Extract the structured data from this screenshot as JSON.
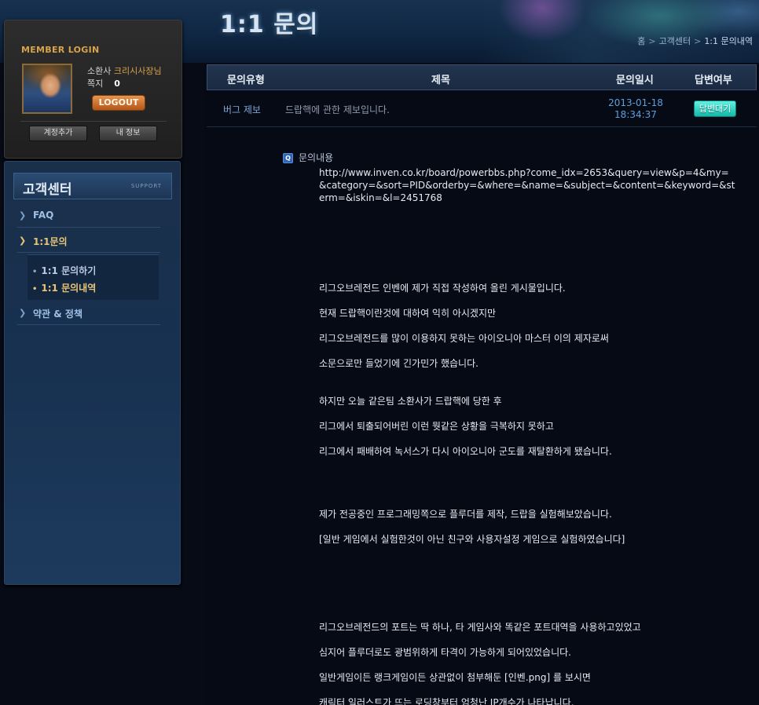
{
  "header": {
    "title": "1:1 문의",
    "breadcrumb": [
      "홈",
      "고객센터",
      "1:1 문의내역"
    ],
    "breadcrumb_sep": ">"
  },
  "login": {
    "title": "MEMBER LOGIN",
    "user_prefix": "소환사",
    "nickname": "크리시사장님",
    "message_label": "쪽지",
    "message_count": "0",
    "logout_label": "LOGOUT",
    "add_account_label": "계정추가",
    "my_info_label": "내 정보"
  },
  "support": {
    "title": "고객센터",
    "subtitle": "SUPPORT",
    "nav": [
      {
        "label": "FAQ"
      },
      {
        "label": "1:1문의"
      },
      {
        "label": "약관 & 정책"
      }
    ],
    "sub_nav": [
      {
        "label": "1:1 문의하기"
      },
      {
        "label": "1:1 문의내역"
      }
    ]
  },
  "table": {
    "headers": {
      "type": "문의유형",
      "subject": "제목",
      "date": "문의일시",
      "status": "답변여부"
    },
    "row": {
      "type": "버그 제보",
      "subject": "드랍핵에 관한 제보입니다.",
      "date": "2013-01-18",
      "time": "18:34:37",
      "status": "답변대기"
    }
  },
  "inquiry": {
    "label": "문의내용",
    "url": "http://www.inven.co.kr/board/powerbbs.php?come_idx=2653&query=view&p=4&my=&category=&sort=PID&orderby=&where=&name=&subject=&content=&keyword=&sterm=&iskin=&l=2451768",
    "lines": [
      "리그오브레전드 인벤에 제가 직접 작성하여 올린 게시물입니다.",
      "현재 드랍핵이란것에 대하여 익히 아시겠지만",
      "리그오브레전드를 많이 이용하지 못하는 아이오니아 마스터 이의 제자로써",
      "소문으로만 들었기에 긴가민가 했습니다.",
      "하지만 오늘 같은팀 소환사가 드랍핵에 당한 후",
      "리그에서 퇴출되어버린 이런 뭣같은 상황을 극복하지 못하고",
      "리그에서 패배하여 녹서스가 다시 아이오니아 군도를 재탈환하게 됐습니다.",
      "제가 전공중인 프로그래밍쪽으로 플루더를 제작, 드랍을 실험해보았습니다.",
      "[일반 게임에서 실험한것이 아닌 친구와 사용자설정 게임으로 실험하였습니다]",
      "리그오브레전드의 포트는 딱 하나, 타 게임사와 똑같은 포트대역을 사용하고있었고",
      "심지어 플루더로도 광범위하게 타격이 가능하게 되어있었습니다.",
      "일반게임이든 랭크게임이든 상관없이 첨부해둔 [인벤.png] 를 보시면",
      "캐릭터 일러스트가 뜨는 로딩창부터 엄청난 IP개수가 나타납니다."
    ]
  }
}
